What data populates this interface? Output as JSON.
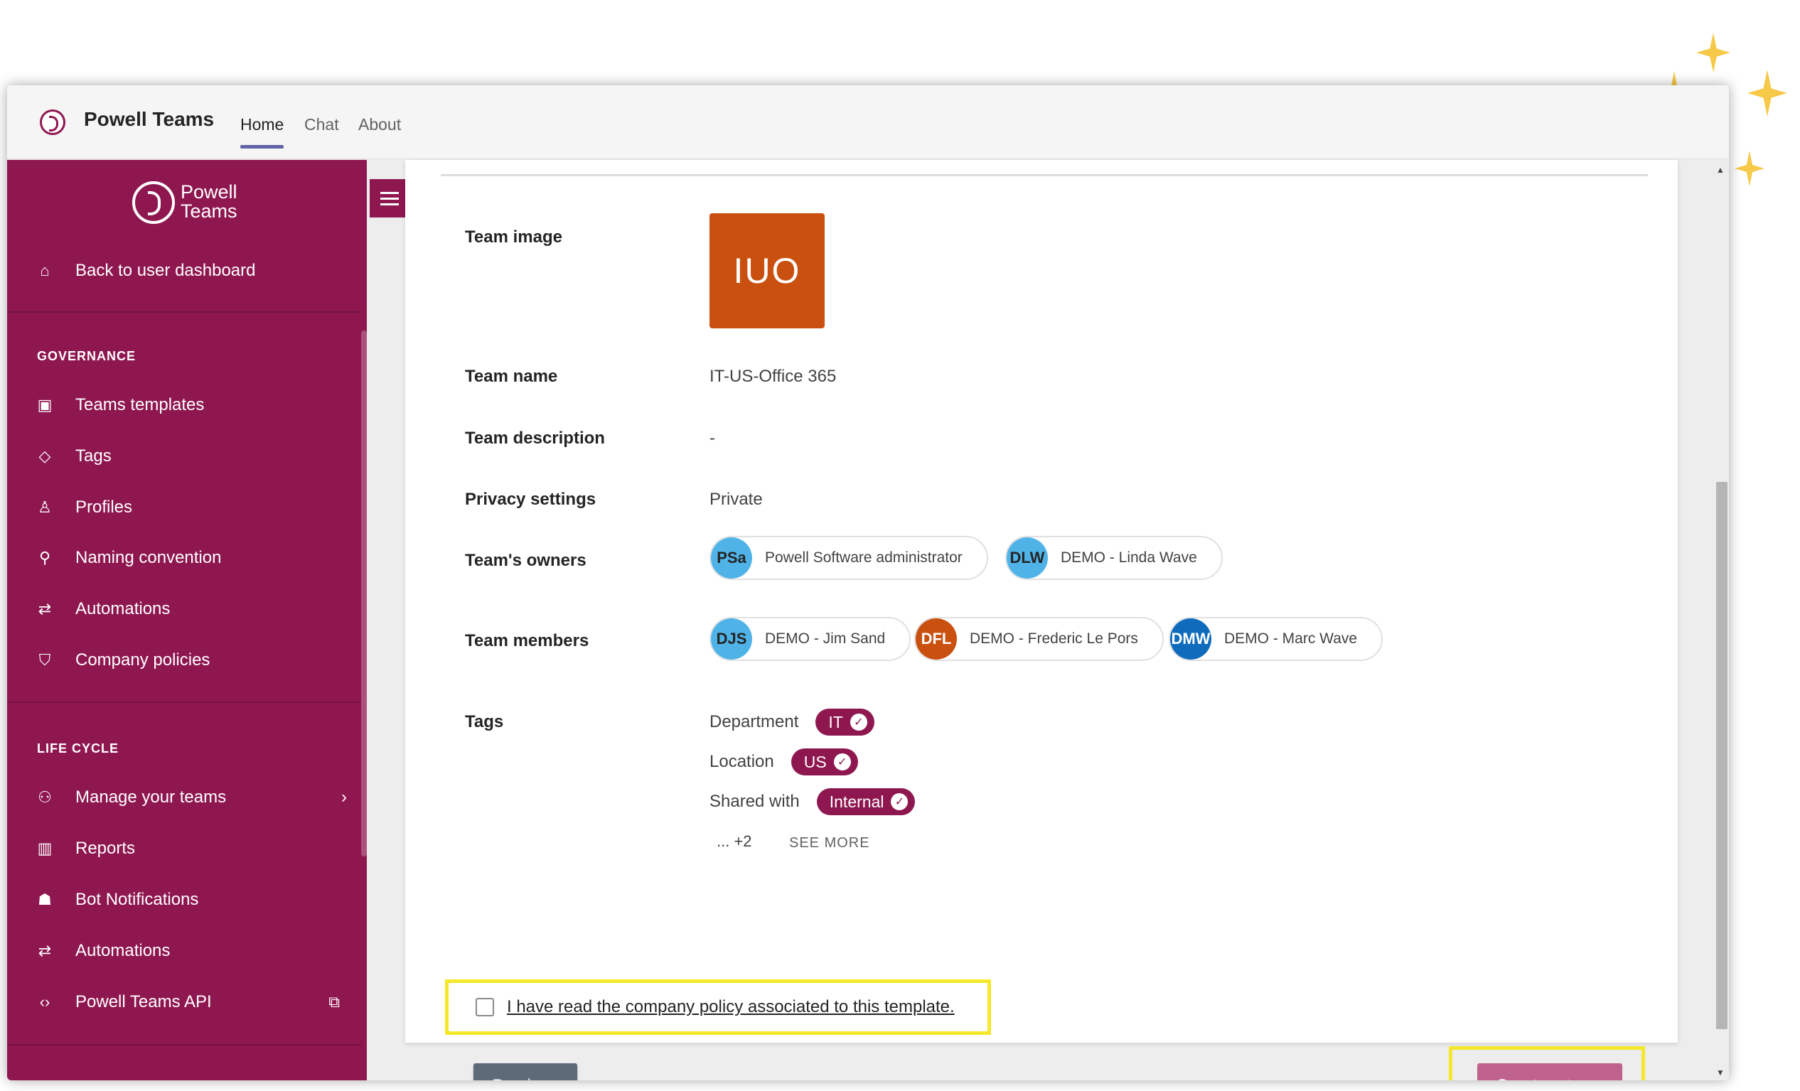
{
  "app": {
    "title": "Powell Teams",
    "tabs": [
      {
        "label": "Home",
        "active": true
      },
      {
        "label": "Chat",
        "active": false
      },
      {
        "label": "About",
        "active": false
      }
    ]
  },
  "sidebar": {
    "brand_line1": "Powell",
    "brand_line2": "Teams",
    "back": {
      "label": "Back to user dashboard",
      "icon": "home-icon"
    },
    "governance_title": "GOVERNANCE",
    "governance_items": [
      {
        "label": "Teams templates",
        "icon": "template-icon"
      },
      {
        "label": "Tags",
        "icon": "tag-icon"
      },
      {
        "label": "Profiles",
        "icon": "person-icon"
      },
      {
        "label": "Naming convention",
        "icon": "stamp-icon"
      },
      {
        "label": "Automations",
        "icon": "automation-icon"
      },
      {
        "label": "Company policies",
        "icon": "policy-icon"
      }
    ],
    "lifecycle_title": "LIFE CYCLE",
    "lifecycle_items": [
      {
        "label": "Manage your teams",
        "icon": "people-icon"
      },
      {
        "label": "Reports",
        "icon": "chart-icon"
      },
      {
        "label": "Bot Notifications",
        "icon": "bot-icon"
      },
      {
        "label": "Automations",
        "icon": "automation-icon"
      },
      {
        "label": "Powell Teams API",
        "icon": "code-icon"
      }
    ]
  },
  "summary": {
    "team_image_label": "Team image",
    "team_image_initials": "IUO",
    "team_name_label": "Team name",
    "team_name": "IT-US-Office 365",
    "team_description_label": "Team description",
    "team_description": "-",
    "privacy_label": "Privacy settings",
    "privacy": "Private",
    "owners_label": "Team's owners",
    "owners": [
      {
        "initials": "PSa",
        "name": "Powell Software administrator",
        "color": "#4fb3e8"
      },
      {
        "initials": "DLW",
        "name": "DEMO - Linda Wave",
        "color": "#4fb3e8"
      }
    ],
    "members_label": "Team members",
    "members": [
      {
        "initials": "DJS",
        "name": "DEMO - Jim Sand",
        "color": "#4fb3e8"
      },
      {
        "initials": "DFL",
        "name": "DEMO - Frederic Le Pors",
        "color": "#ca5010"
      },
      {
        "initials": "DMW",
        "name": "DEMO - Marc Wave",
        "color": "#0f6cbd"
      }
    ],
    "tags_label": "Tags",
    "tags": [
      {
        "name": "Department",
        "value": "IT"
      },
      {
        "name": "Location",
        "value": "US"
      },
      {
        "name": "Shared with",
        "value": "Internal"
      }
    ],
    "more_count": "... +2",
    "see_more": "SEE MORE"
  },
  "policy": {
    "checkbox_label": "I have read the company policy associated to this template.",
    "checked": false
  },
  "buttons": {
    "previous": "Previous",
    "create": "Create a team"
  },
  "colors": {
    "brand": "#8f1750",
    "highlight": "#f5e82a",
    "create_button": "#c0628e",
    "previous_button": "#5d6b78"
  }
}
